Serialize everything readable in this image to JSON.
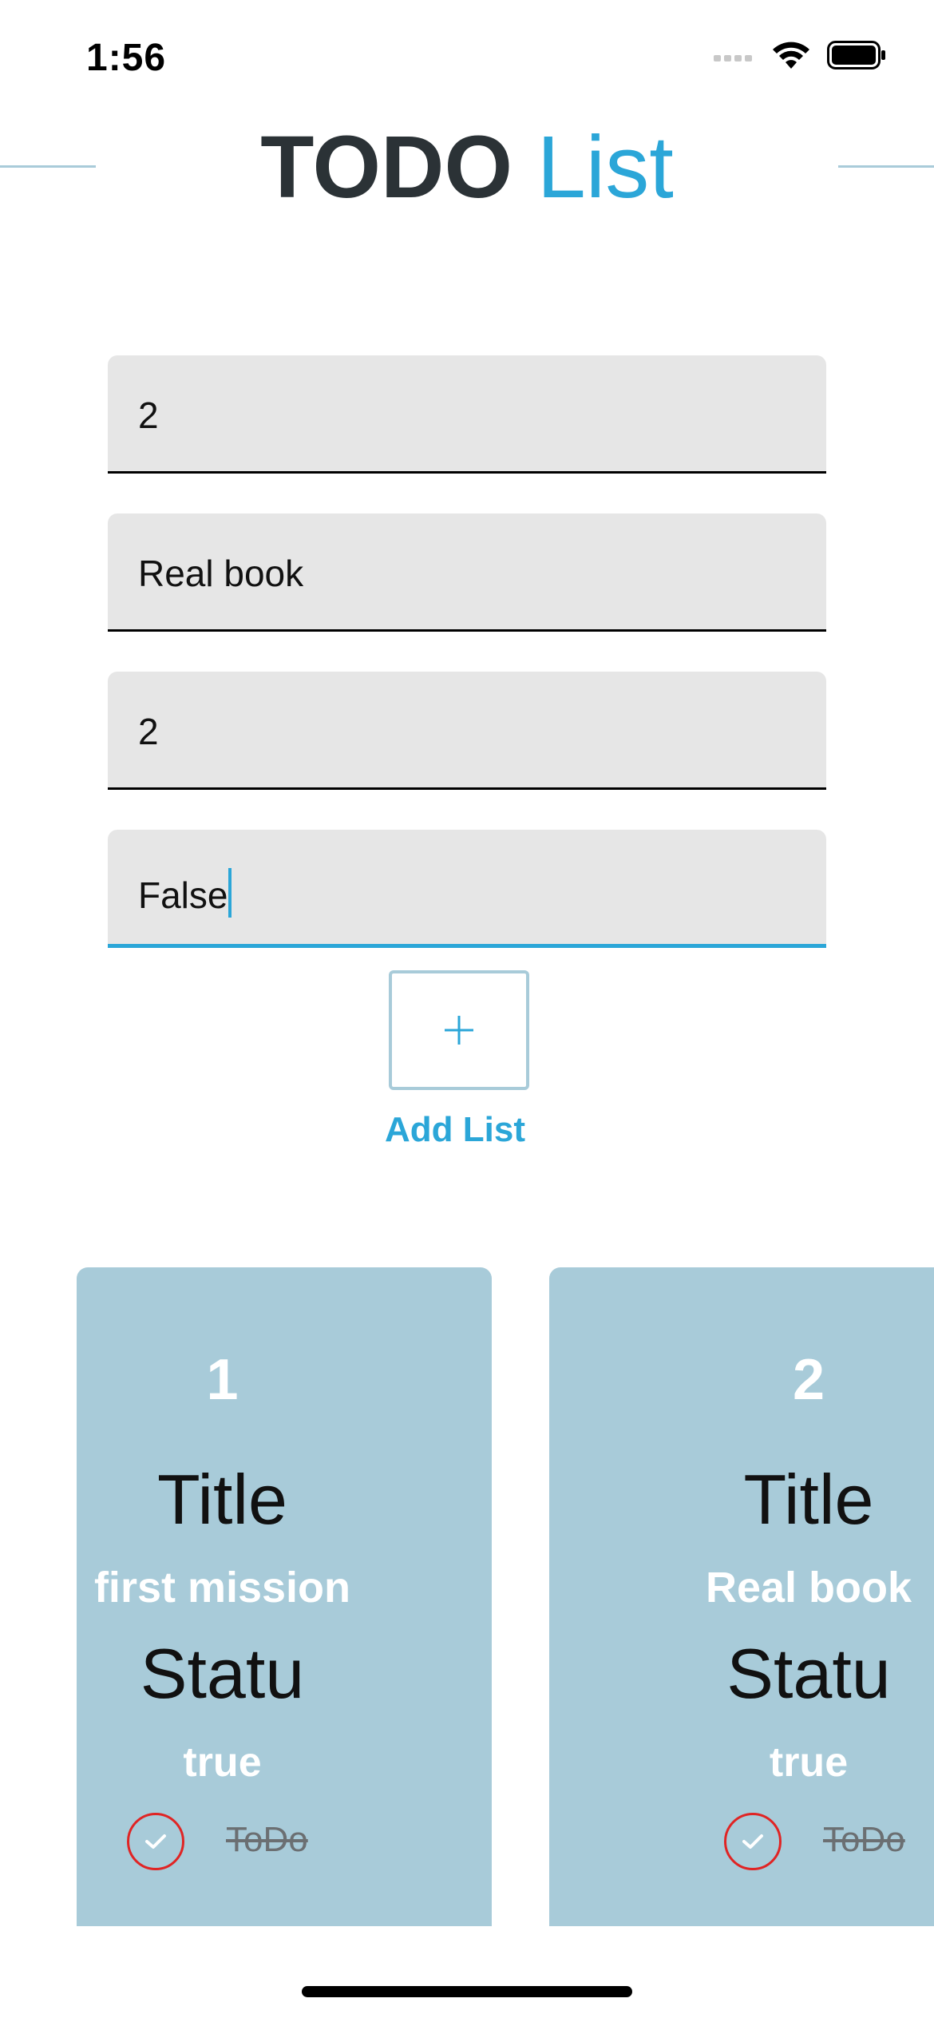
{
  "status_bar": {
    "time": "1:56"
  },
  "header": {
    "title_strong": "TODO",
    "title_light": "List"
  },
  "form": {
    "fields": [
      {
        "value": "2"
      },
      {
        "value": "Real book"
      },
      {
        "value": "2"
      },
      {
        "value": "False"
      }
    ],
    "add_label": "Add List"
  },
  "cards": [
    {
      "id": "1",
      "title_label": "Title",
      "title_value": "first mission",
      "status_label": "Statu",
      "status_value": "true",
      "todo_label": "ToDo"
    },
    {
      "id": "2",
      "title_label": "Title",
      "title_value": "Real book",
      "status_label": "Statu",
      "status_value": "true",
      "todo_label": "ToDo"
    }
  ],
  "colors": {
    "accent": "#2ba6d8",
    "card_bg": "#a8cbd9",
    "field_bg": "#e6e6e6",
    "title_dark": "#2b3236",
    "check_red": "#e02424"
  }
}
